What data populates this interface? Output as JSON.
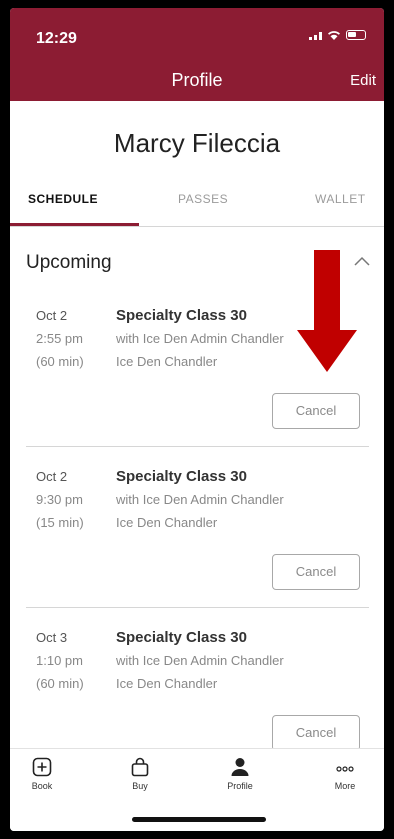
{
  "status": {
    "time": "12:29"
  },
  "header": {
    "title": "Profile",
    "edit_label": "Edit"
  },
  "profile": {
    "name": "Marcy Fileccia"
  },
  "tabs": [
    {
      "label": "SCHEDULE",
      "active": true
    },
    {
      "label": "PASSES",
      "active": false
    },
    {
      "label": "WALLET",
      "active": false
    }
  ],
  "upcoming": {
    "title": "Upcoming",
    "items": [
      {
        "date": "Oct 2",
        "time": "2:55 pm",
        "duration": "(60 min)",
        "class_name": "Specialty Class 30",
        "instructor": "with Ice Den Admin Chandler",
        "location": "Ice Den Chandler",
        "cancel_label": "Cancel"
      },
      {
        "date": "Oct 2",
        "time": "9:30 pm",
        "duration": "(15 min)",
        "class_name": "Specialty Class 30",
        "instructor": "with Ice Den Admin Chandler",
        "location": "Ice Den Chandler",
        "cancel_label": "Cancel"
      },
      {
        "date": "Oct 3",
        "time": "1:10 pm",
        "duration": "(60 min)",
        "class_name": "Specialty Class 30",
        "instructor": "with Ice Den Admin Chandler",
        "location": "Ice Den Chandler",
        "cancel_label": "Cancel"
      }
    ]
  },
  "tabbar": [
    {
      "label": "Book",
      "icon": "plus-square-icon"
    },
    {
      "label": "Buy",
      "icon": "shopping-bag-icon"
    },
    {
      "label": "Profile",
      "icon": "person-icon"
    },
    {
      "label": "More",
      "icon": "more-dots-icon"
    }
  ],
  "colors": {
    "brand": "#8c1c33",
    "annotation_arrow": "#c00000"
  }
}
